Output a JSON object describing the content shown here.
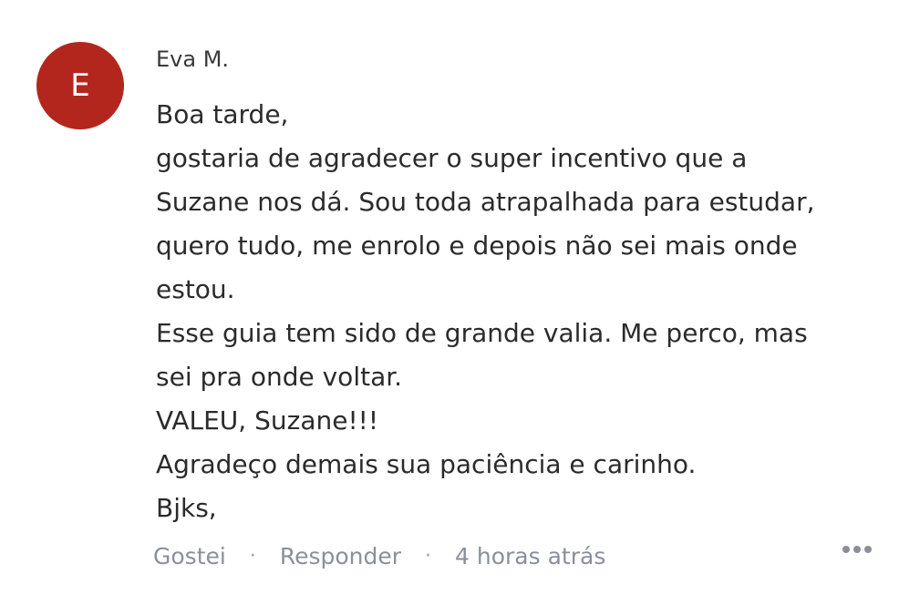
{
  "comment": {
    "avatar_letter": "E",
    "avatar_color": "#b3261e",
    "author": "Eva M.",
    "lines": [
      "Boa tarde,",
      "gostaria de agradecer o super incentivo que a",
      "Suzane nos dá. Sou toda atrapalhada para estudar,",
      "quero tudo, me enrolo e depois não sei mais onde",
      "estou.",
      "Esse guia tem sido de grande valia. Me perco, mas",
      "sei pra onde voltar.",
      "VALEU, Suzane!!!",
      "Agradeço demais sua paciência e carinho.",
      "Bjks,"
    ],
    "actions": {
      "like": "Gostei",
      "separator": "·",
      "reply": "Responder",
      "timestamp": "4 horas atrás"
    },
    "more_icon": "more-horizontal-icon"
  }
}
